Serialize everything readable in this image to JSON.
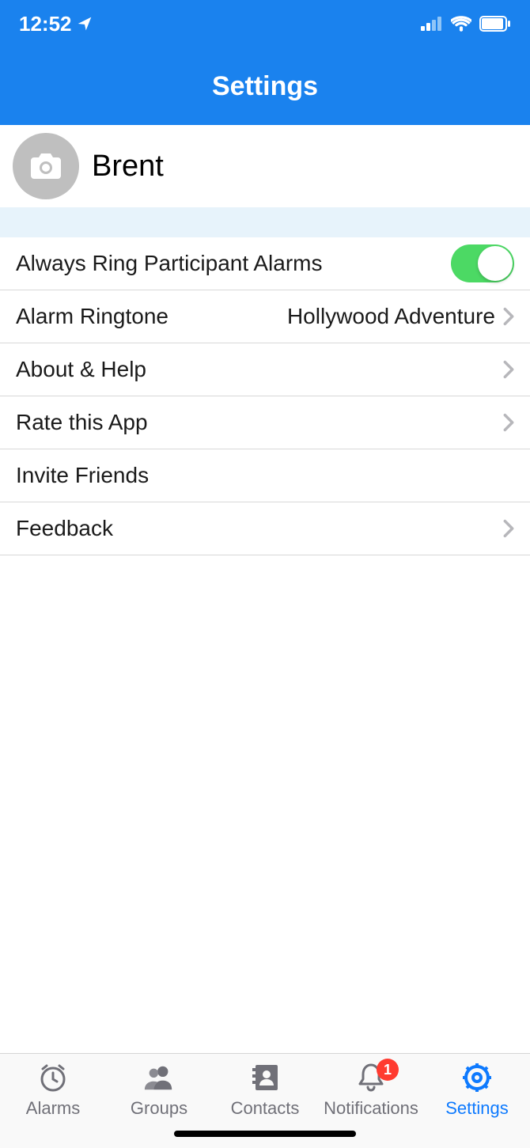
{
  "status": {
    "time": "12:52"
  },
  "header": {
    "title": "Settings"
  },
  "profile": {
    "username": "Brent"
  },
  "rows": {
    "alwaysRing": {
      "label": "Always Ring Participant Alarms",
      "on": true
    },
    "ringtone": {
      "label": "Alarm Ringtone",
      "value": "Hollywood Adventure"
    },
    "about": {
      "label": "About & Help"
    },
    "rate": {
      "label": "Rate this App"
    },
    "invite": {
      "label": "Invite Friends"
    },
    "feedback": {
      "label": "Feedback"
    }
  },
  "tabs": {
    "alarms": "Alarms",
    "groups": "Groups",
    "contacts": "Contacts",
    "notifications": "Notifications",
    "notificationsBadge": "1",
    "settings": "Settings"
  }
}
